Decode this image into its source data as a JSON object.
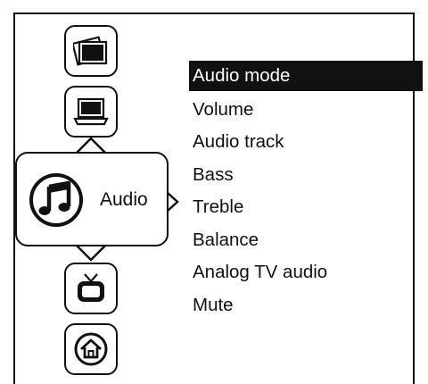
{
  "category_icons": [
    {
      "icon": "picture-icon"
    },
    {
      "icon": "laptop-icon"
    },
    {
      "icon": "music-note-icon",
      "label": "Audio",
      "selected": true
    },
    {
      "icon": "tv-icon"
    },
    {
      "icon": "home-icon"
    }
  ],
  "selected_category": {
    "label": "Audio",
    "icon": "music-note-icon"
  },
  "audio_menu": {
    "items": [
      {
        "label": "Audio mode",
        "highlighted": true
      },
      {
        "label": "Volume"
      },
      {
        "label": "Audio track"
      },
      {
        "label": "Bass"
      },
      {
        "label": "Treble"
      },
      {
        "label": "Balance"
      },
      {
        "label": "Analog TV audio"
      },
      {
        "label": "Mute"
      }
    ]
  },
  "colors": {
    "foreground": "#111111",
    "background": "#ffffff",
    "highlight_bg": "#111111",
    "highlight_text": "#ffffff"
  }
}
